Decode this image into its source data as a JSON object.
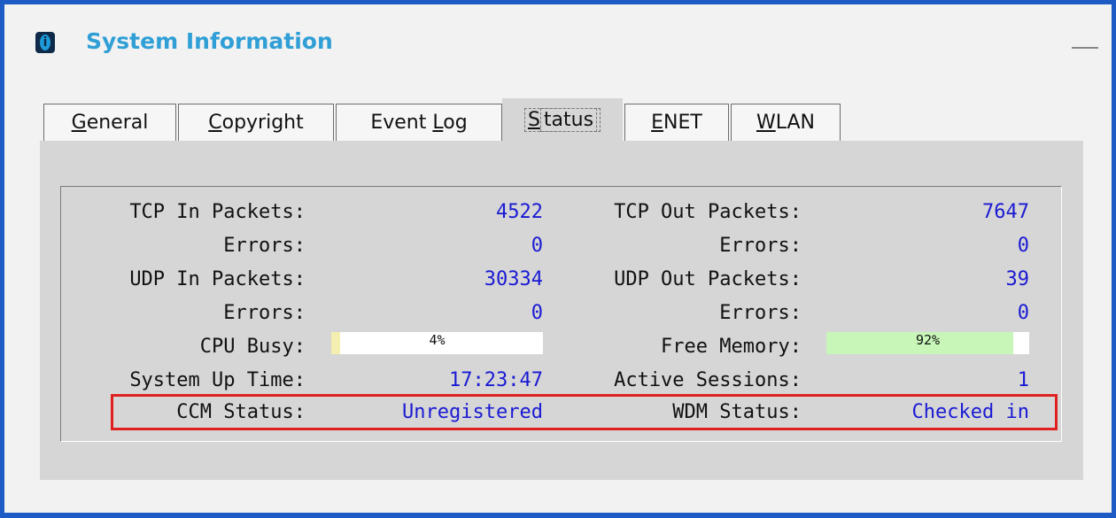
{
  "window": {
    "title": "System Information"
  },
  "tabs": [
    {
      "label_u": "G",
      "label_rest": "eneral"
    },
    {
      "label_u": "C",
      "label_rest": "opyright"
    },
    {
      "label_pre": "Event ",
      "label_u": "L",
      "label_rest": "og"
    },
    {
      "label_u": "S",
      "label_rest": "tatus"
    },
    {
      "label_u": "E",
      "label_rest": "NET"
    },
    {
      "label_u": "W",
      "label_rest": "LAN"
    }
  ],
  "stats": {
    "tcp_in_label": "TCP In Packets:",
    "tcp_in": "4522",
    "tcp_out_label": "TCP Out Packets:",
    "tcp_out": "7647",
    "tcp_in_err_label": "Errors:",
    "tcp_in_err": "0",
    "tcp_out_err_label": "Errors:",
    "tcp_out_err": "0",
    "udp_in_label": "UDP In Packets:",
    "udp_in": "30334",
    "udp_out_label": "UDP Out Packets:",
    "udp_out": "39",
    "udp_in_err_label": "Errors:",
    "udp_in_err": "0",
    "udp_out_err_label": "Errors:",
    "udp_out_err": "0",
    "cpu_label": "CPU Busy:",
    "cpu": "4%",
    "cpu_fraction": 0.04,
    "mem_label": "Free Memory:",
    "mem": "92%",
    "mem_fraction": 0.92,
    "uptime_label": "System Up Time:",
    "uptime": "17:23:47",
    "sessions_label": "Active Sessions:",
    "sessions": "1",
    "ccm_label": "CCM Status:",
    "ccm": "Unregistered",
    "wdm_label": "WDM Status:",
    "wdm": "Checked in"
  },
  "colors": {
    "cpu_fill": "#f4eeb0",
    "mem_fill": "#c8f5b8",
    "highlight": "#e02020"
  }
}
